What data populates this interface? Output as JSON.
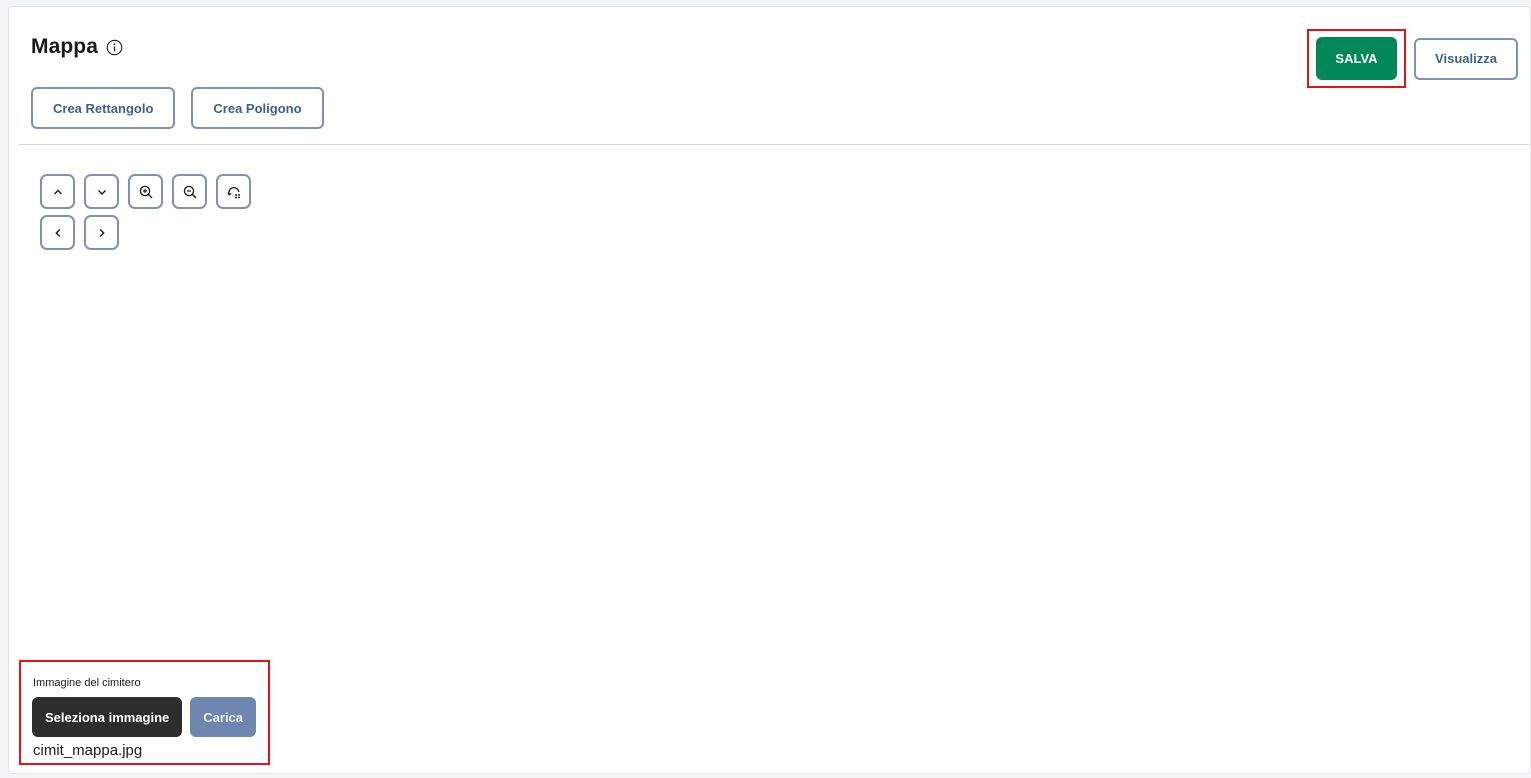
{
  "header": {
    "title": "Mappa",
    "info_icon": "info-circle-icon"
  },
  "actions": {
    "save_label": "SALVA",
    "view_label": "Visualizza"
  },
  "create": {
    "rectangle_label": "Crea Rettangolo",
    "polygon_label": "Crea Poligono"
  },
  "map_controls": {
    "row1": [
      "chevron-up-icon",
      "chevron-down-icon",
      "zoom-in-icon",
      "zoom-out-icon",
      "reset-view-icon"
    ],
    "row2": [
      "chevron-left-icon",
      "chevron-right-icon"
    ]
  },
  "upload": {
    "label": "Immagine del cimitero",
    "select_label": "Seleziona immagine",
    "upload_label": "Carica",
    "filename": "cimit_mappa.jpg"
  },
  "colors": {
    "primary_green": "#008758",
    "outline_blue": "#7d92b4",
    "highlight_red": "#e0151a",
    "dark_button": "#2d2d2d",
    "disabled_button": "#6f86b0"
  }
}
